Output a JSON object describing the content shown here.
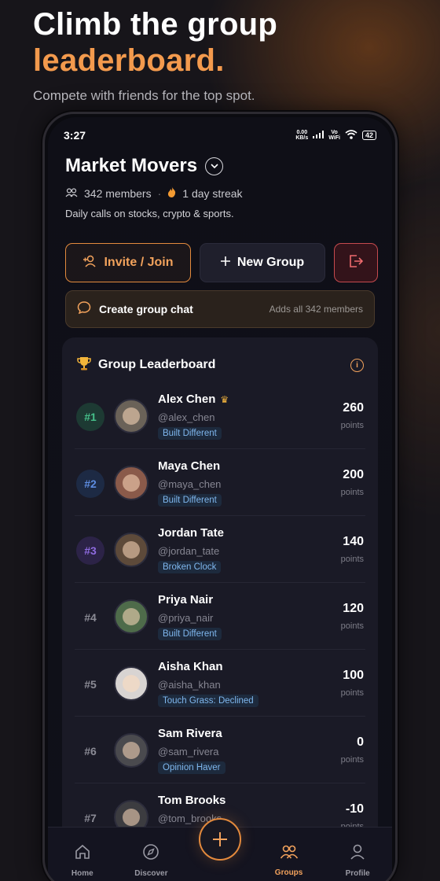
{
  "hero": {
    "line1": "Climb the group",
    "line2": "leaderboard.",
    "subtitle": "Compete with friends for the top spot."
  },
  "statusbar": {
    "time": "3:27",
    "net_speed_top": "0.00",
    "net_speed_unit": "KB/s",
    "wifi_label_top": "Vo",
    "wifi_label_bottom": "WiFi",
    "battery": "42"
  },
  "group": {
    "name": "Market Movers",
    "members": "342 members",
    "streak": "1 day streak",
    "description": "Daily calls on stocks, crypto & sports."
  },
  "actions": {
    "invite_label": "Invite / Join",
    "new_group_label": "New Group"
  },
  "chat": {
    "label": "Create group chat",
    "sub": "Adds all 342 members"
  },
  "leaderboard": {
    "title": "Group Leaderboard",
    "points_label": "points",
    "rows": [
      {
        "rank": "#1",
        "name": "Alex Chen",
        "handle": "@alex_chen",
        "badge": "Built Different",
        "points": "260",
        "avatar_color": "#6a6258"
      },
      {
        "rank": "#2",
        "name": "Maya Chen",
        "handle": "@maya_chen",
        "badge": "Built Different",
        "points": "200",
        "avatar_color": "#8a5a4a"
      },
      {
        "rank": "#3",
        "name": "Jordan Tate",
        "handle": "@jordan_tate",
        "badge": "Broken Clock",
        "points": "140",
        "avatar_color": "#5d4a3a"
      },
      {
        "rank": "#4",
        "name": "Priya Nair",
        "handle": "@priya_nair",
        "badge": "Built Different",
        "points": "120",
        "avatar_color": "#4e6b4a"
      },
      {
        "rank": "#5",
        "name": "Aisha Khan",
        "handle": "@aisha_khan",
        "badge": "Touch Grass: Declined",
        "points": "100",
        "avatar_color": "#d8d4d2"
      },
      {
        "rank": "#6",
        "name": "Sam Rivera",
        "handle": "@sam_rivera",
        "badge": "Opinion Haver",
        "points": "0",
        "avatar_color": "#4a4a4e"
      },
      {
        "rank": "#7",
        "name": "Tom Brooks",
        "handle": "@tom_brooks",
        "badge": "",
        "points": "-10",
        "avatar_color": "#3c3c40"
      }
    ]
  },
  "tabs": {
    "home": "Home",
    "discover": "Discover",
    "groups": "Groups",
    "profile": "Profile"
  },
  "colors": {
    "accent": "#f2a25c",
    "background": "#0f0f17"
  }
}
